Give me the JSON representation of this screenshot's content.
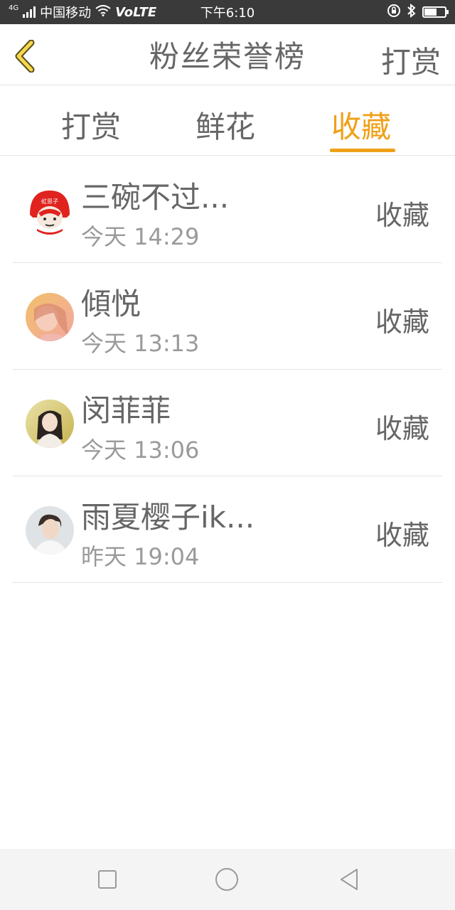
{
  "status_bar": {
    "network_type": "4G",
    "carrier": "中国移动",
    "volte": "VoLTE",
    "time": "下午6:10",
    "battery_percent": 60
  },
  "header": {
    "title": "粉丝荣誉榜",
    "action_label": "打赏",
    "back_icon": "chevron-left-icon"
  },
  "tabs": [
    {
      "label": "打赏",
      "active": false
    },
    {
      "label": "鲜花",
      "active": false
    },
    {
      "label": "收藏",
      "active": true
    }
  ],
  "accent_color": "#f0a018",
  "list": [
    {
      "name": "三碗不过...",
      "time": "今天 14:29",
      "action": "收藏",
      "avatar_text": "虹思子"
    },
    {
      "name": "傾悦",
      "time": "今天 13:13",
      "action": "收藏"
    },
    {
      "name": "闵菲菲",
      "time": "今天 13:06",
      "action": "收藏"
    },
    {
      "name": "雨夏樱子ik...",
      "time": "昨天 19:04",
      "action": "收藏"
    }
  ],
  "nav_bar": {
    "buttons": [
      "square-icon",
      "circle-icon",
      "triangle-back-icon"
    ]
  }
}
